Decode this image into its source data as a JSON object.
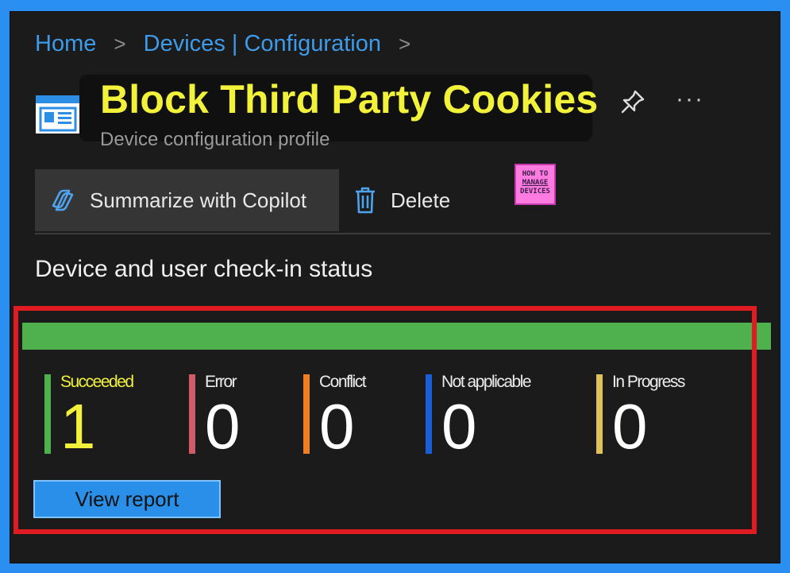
{
  "breadcrumb": {
    "items": [
      "Home",
      "Devices | Configuration"
    ],
    "separator": ">"
  },
  "header": {
    "title": "Block Third Party Cookies",
    "subtitle": "Device configuration profile",
    "more_label": "···"
  },
  "commands": {
    "copilot_label": "Summarize with Copilot",
    "delete_label": "Delete"
  },
  "watermark": {
    "line1": "HOW TO",
    "line2": "MANAGE",
    "line3": "DEVICES"
  },
  "section": {
    "heading": "Device and user check-in status"
  },
  "status": {
    "succeeded_fraction": 1.0,
    "tiles": [
      {
        "label": "Succeeded",
        "value": "1",
        "color": "#4fb04e"
      },
      {
        "label": "Error",
        "value": "0",
        "color": "#d15b68"
      },
      {
        "label": "Conflict",
        "value": "0",
        "color": "#f07c24"
      },
      {
        "label": "Not applicable",
        "value": "0",
        "color": "#1a5fd6"
      },
      {
        "label": "In Progress",
        "value": "0",
        "color": "#e0c157"
      }
    ]
  },
  "actions": {
    "view_report_label": "View report"
  },
  "colors": {
    "accent": "#3d9be9",
    "highlight": "#f2f23a",
    "annotation_red": "#e11b22",
    "background": "#1b1b1b",
    "outer_frame": "#2a8ff0"
  }
}
